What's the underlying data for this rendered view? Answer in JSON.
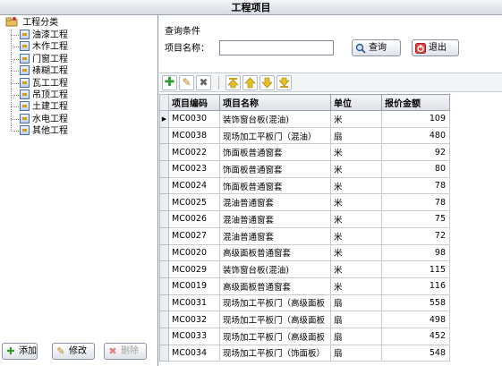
{
  "window": {
    "title": "工程项目"
  },
  "tree": {
    "root": "工程分类",
    "items": [
      "油漆工程",
      "木作工程",
      "门窗工程",
      "裱糊工程",
      "瓦工工程",
      "吊顶工程",
      "土建工程",
      "水电工程",
      "其他工程"
    ]
  },
  "left_buttons": {
    "add": "添加",
    "edit": "修改",
    "delete": "删除"
  },
  "query": {
    "title": "查询条件",
    "name_label": "项目名称：",
    "name_value": "",
    "search_label": "查询",
    "exit_label": "退出"
  },
  "toolbar": {
    "icons": [
      "add-icon",
      "edit-icon",
      "delete-icon",
      "move-top-icon",
      "move-up-icon",
      "move-down-icon",
      "move-bottom-icon"
    ]
  },
  "table": {
    "headers": [
      "项目编码",
      "项目名称",
      "单位",
      "报价金额"
    ],
    "rows": [
      [
        "MC0030",
        "装饰窗台板(混油)",
        "米",
        "109"
      ],
      [
        "MC0038",
        "现场加工平板门（混油）",
        "扇",
        "480"
      ],
      [
        "MC0022",
        "饰面板普通窗套",
        "米",
        "92"
      ],
      [
        "MC0023",
        "饰面板普通窗套",
        "米",
        "80"
      ],
      [
        "MC0024",
        "饰面板普通窗套",
        "米",
        "78"
      ],
      [
        "MC0025",
        "混油普通窗套",
        "米",
        "78"
      ],
      [
        "MC0026",
        "混油普通窗套",
        "米",
        "75"
      ],
      [
        "MC0027",
        "混油普通窗套",
        "米",
        "72"
      ],
      [
        "MC0020",
        "高级面板普通窗套",
        "米",
        "98"
      ],
      [
        "MC0029",
        "装饰窗台板(混油)",
        "米",
        "115"
      ],
      [
        "MC0019",
        "高级面板普通窗套",
        "米",
        "116"
      ],
      [
        "MC0031",
        "现场加工平板门（高级面板",
        "扇",
        "558"
      ],
      [
        "MC0032",
        "现场加工平板门（高级面板",
        "扇",
        "498"
      ],
      [
        "MC0033",
        "现场加工平板门（高级面板",
        "扇",
        "452"
      ],
      [
        "MC0034",
        "现场加工平板门（饰面板）",
        "扇",
        "548"
      ]
    ],
    "selected_row": 0
  },
  "colors": {
    "accent": "#3a6fb0",
    "add_green": "#2e9a2e",
    "delete_red": "#cc2a2a"
  }
}
